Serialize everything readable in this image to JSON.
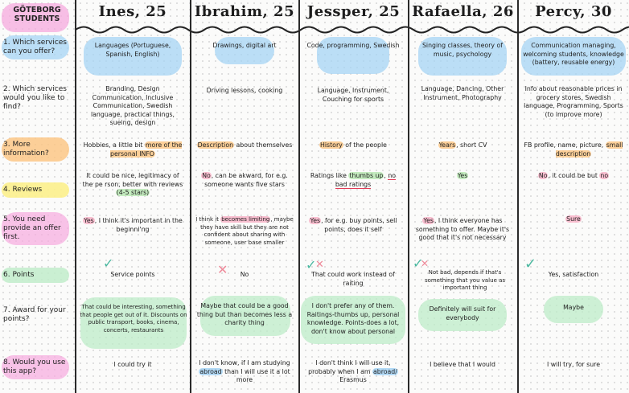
{
  "corner_label": "Göteborg students",
  "participants": [
    "Ines, 25",
    "Ibrahim, 25",
    "Jessper, 25",
    "Rafaella, 26",
    "Percy, 30"
  ],
  "questions": [
    "1. Which services can you offer?",
    "2. Which services would you like to find?",
    "3. More information?",
    "4. Reviews",
    "5. You need provide an offer first.",
    "6. Points",
    "7. Award for your points?",
    "8. Would you use this app?"
  ],
  "answers": {
    "q1": [
      "Languages (Portuguese, Spanish, English)",
      "Drawings, digital art",
      "Code, programming, Swedish",
      "Singing classes, theory of music, psychology",
      "Communication managing, welcoming students, knowledge (battery, reusable energy)"
    ],
    "q2": [
      "Branding, Design Communication, Inclusive Communication, Swedish language, practical things, sueing, design",
      "Driving lessons, cooking",
      "Language, Instrument, Couching for sports",
      "Language, Dancing, Other Instrument, Photography",
      "Info about reasonable prices in grocery stores, Swedish language, Programming, Sports (to improve more)"
    ],
    "q3": {
      "ines": {
        "pre": "Hobbies, a little bit ",
        "hl": "more of the personal INFO"
      },
      "ibrahim": {
        "hl": "Description",
        "post": " about themselves"
      },
      "jessper": {
        "hl": "History",
        "post": " of the people"
      },
      "rafaella": {
        "hl": "Years",
        "post": ", short CV"
      },
      "percy": {
        "pre": "FB profile, name, picture, ",
        "hl": "small description"
      }
    },
    "q4": {
      "ines": {
        "pre": "It could be nice, legitimacy of the pe rson, better with reviews ",
        "hl": "(4-5 stars)"
      },
      "ibrahim": {
        "hl": "No",
        "post": ", can be akward, for e.g. someone wants five stars"
      },
      "jessper": {
        "pre": "Ratings like ",
        "hl": "thumbs up",
        "mid": ", ",
        "ul": "no bad ratings"
      },
      "rafaella": {
        "hl": "Yes"
      },
      "percy": {
        "hl": "No",
        "mid": ", it could be but ",
        "hl2": "no"
      }
    },
    "q5": {
      "ines": {
        "hl": "Yes",
        "post": ", I think it's important in the beginni'ng"
      },
      "ibrahim": {
        "pre": "I think it ",
        "hl": "becomes limiting",
        "post": ", maybe they have skill but they are not confident about sharing with someone, user base smaller"
      },
      "jessper": {
        "hl": "Yes",
        "post": ", for e.g. buy points, sell points, does it self"
      },
      "rafaella": {
        "hl": "Yes",
        "post": ", I think everyone has something to offer. Maybe it's good that it's not necessary"
      },
      "percy": {
        "hl": "Sure"
      }
    },
    "q6": [
      "Service points",
      "No",
      "That could work instead of raiting",
      "Not bad, depends if that's something that you value as important thing",
      "Yes, satisfaction"
    ],
    "q7": [
      "That could be interesting, something that people get out of it. Discounts on public transport, books, cinema, concerts, restaurants",
      "Maybe that could be a good thing but than becomes less a charity thing",
      "I don't prefer any of them. Raitings-thumbs up, personal knowledge. Points-does a lot, don't know about personal",
      "Definitely will suit for everybody",
      "Maybe"
    ],
    "q8": {
      "ines": "I could try it",
      "ibrahim": {
        "pre": "I don't know, if I am studying ",
        "hl": "abroad",
        "post": " than I will use it a lot more"
      },
      "jessper": {
        "pre": "I don't think I will use it, probably when I am ",
        "hl": "abroad/",
        "post": " Erasmus"
      },
      "rafaella": "I believe that I would",
      "percy": "I will try, for sure"
    }
  },
  "points_marks": [
    "check",
    "cross",
    "check-cross",
    "check-cross",
    "check"
  ],
  "colors": {
    "blue": "#a6d4f4",
    "green": "#beecc8",
    "pink": "#f6aade",
    "orange": "#fcc480",
    "yellow": "#fcf08c",
    "check": "#4bb8a0",
    "cross": "#ee8a9a"
  }
}
